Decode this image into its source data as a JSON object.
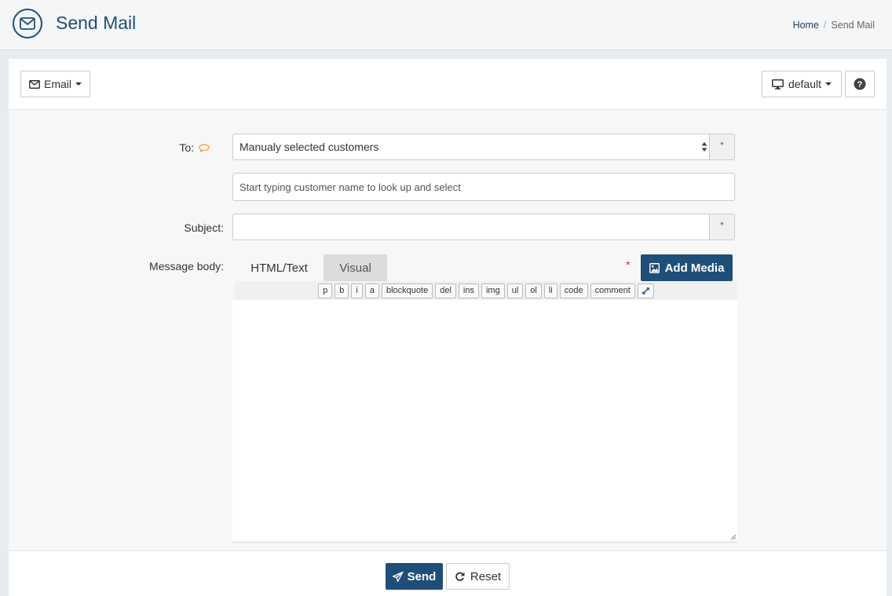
{
  "header": {
    "title": "Send Mail",
    "breadcrumb": {
      "home": "Home",
      "separator": "/",
      "current": "Send Mail"
    }
  },
  "toolbar": {
    "email_label": "Email",
    "template_label": "default",
    "help_icon": "question-circle-icon"
  },
  "form": {
    "to_label": "To:",
    "to_selected": "Manualy selected customers",
    "customer_lookup_placeholder": "Start typing customer name to look up and select",
    "subject_label": "Subject:",
    "subject_value": "",
    "required_mark": "*",
    "message_label": "Message body:",
    "tabs": [
      "HTML/Text",
      "Visual"
    ],
    "add_media_label": "Add Media",
    "quicktags": [
      "p",
      "b",
      "i",
      "a",
      "blockquote",
      "del",
      "ins",
      "img",
      "ul",
      "ol",
      "li",
      "code",
      "comment"
    ],
    "body_value": ""
  },
  "footer": {
    "send_label": "Send",
    "reset_label": "Reset"
  },
  "colors": {
    "brand": "#1f4e79",
    "required": "#c9302c",
    "tooltip_icon": "#f0a030"
  }
}
